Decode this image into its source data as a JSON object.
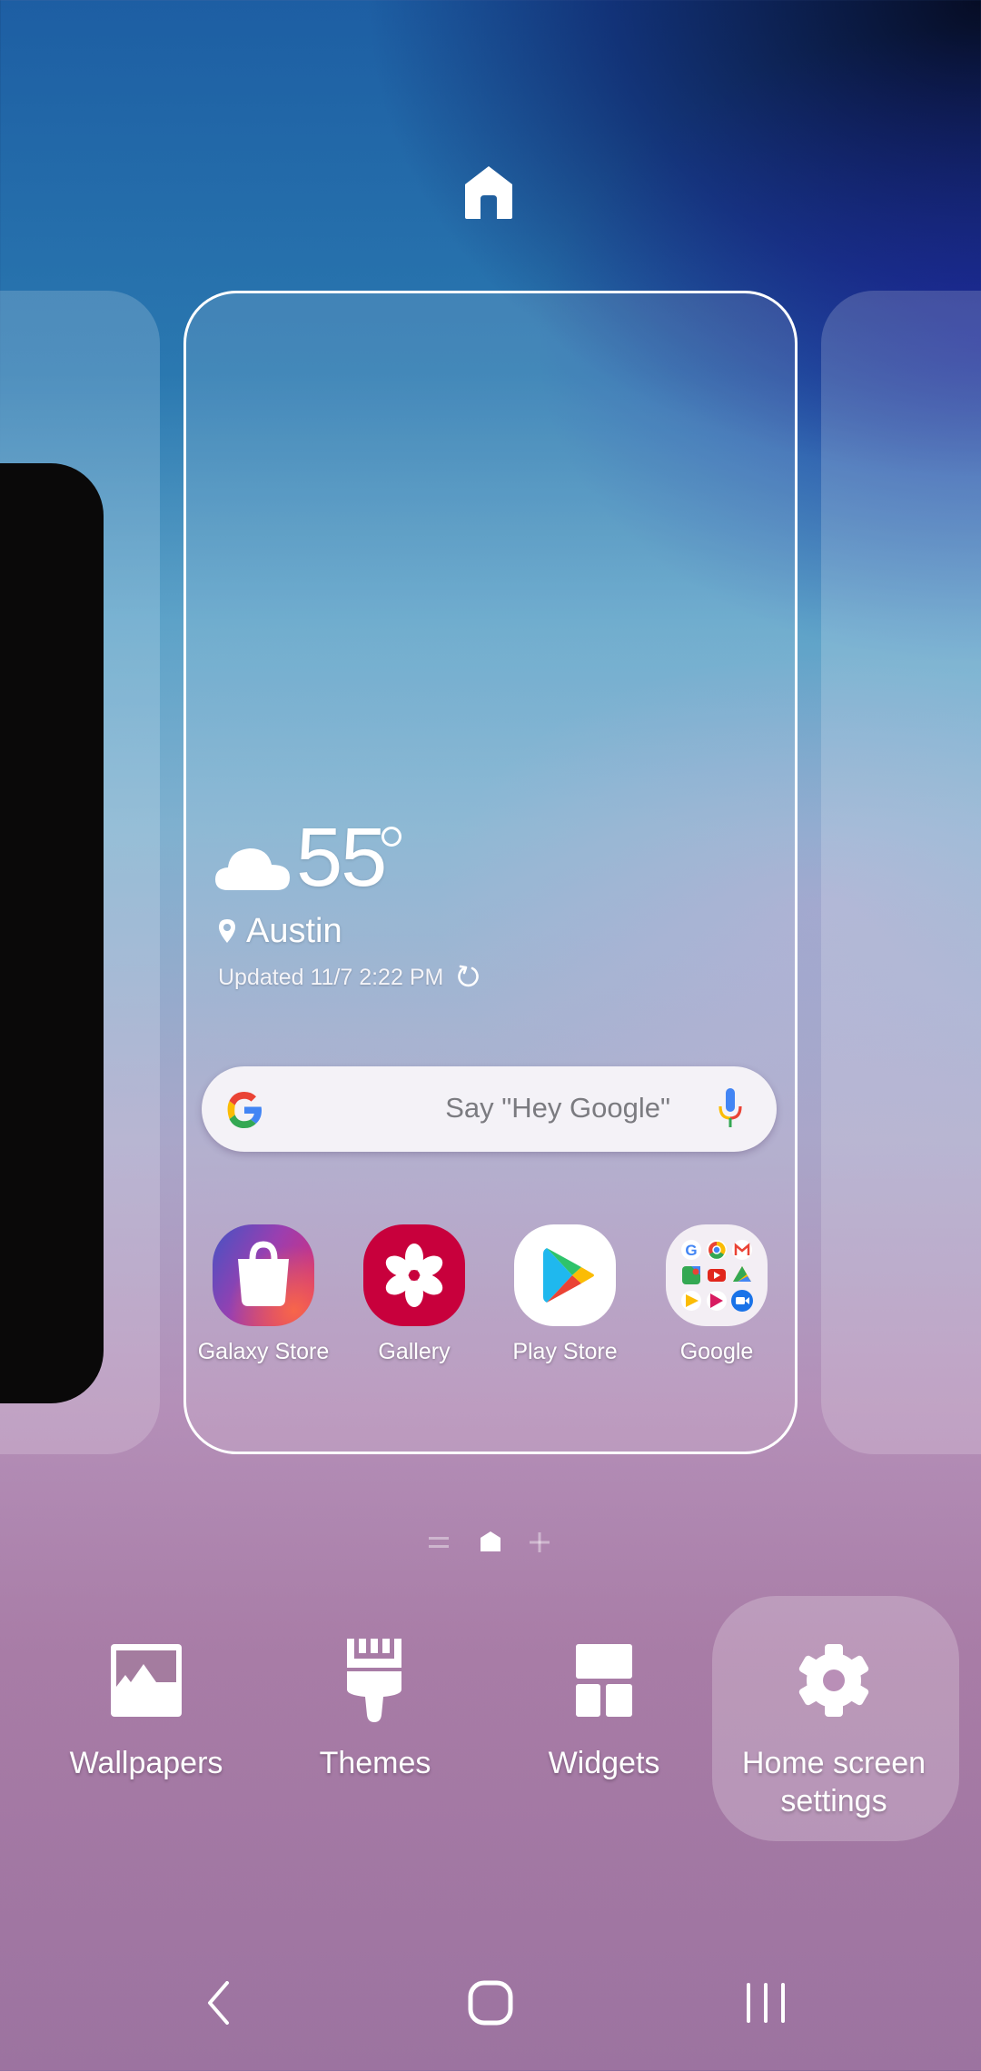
{
  "top_indicator": {
    "icon": "home-icon"
  },
  "pages": {
    "current": 2,
    "indicator": [
      {
        "icon": "equals-icon",
        "label": "Left page"
      },
      {
        "icon": "home-icon",
        "label": "Home page",
        "active": true
      },
      {
        "icon": "plus-icon",
        "label": "Add page"
      }
    ]
  },
  "weather": {
    "condition_icon": "cloud-icon",
    "temperature": "55",
    "unit_symbol": "°",
    "location_icon": "location-pin-icon",
    "city": "Austin",
    "updated": "Updated 11/7 2:22 PM",
    "refresh_icon": "refresh-icon"
  },
  "search": {
    "logo": "google-g-logo",
    "placeholder": "Say \"Hey Google\"",
    "mic_icon": "mic-icon"
  },
  "apps": [
    {
      "label": "Galaxy Store",
      "icon": "shopping-bag-icon"
    },
    {
      "label": "Gallery",
      "icon": "flower-icon"
    },
    {
      "label": "Play Store",
      "icon": "play-triangle-icon"
    },
    {
      "label": "Google",
      "icon": "folder-icon"
    }
  ],
  "bottom_menu": [
    {
      "label": "Wallpapers",
      "icon": "wallpaper-icon"
    },
    {
      "label": "Themes",
      "icon": "paintbrush-icon"
    },
    {
      "label": "Widgets",
      "icon": "widgets-icon"
    },
    {
      "label": "Home screen settings",
      "icon": "gear-icon",
      "highlighted": true
    }
  ],
  "nav": {
    "back": "back-icon",
    "home": "home-button-icon",
    "recents": "recents-icon"
  },
  "colors": {
    "card_border": "#ffffff",
    "gallery_red": "#c8003c",
    "search_bg": "#f4f2f7",
    "search_hint": "#7b7b80"
  }
}
